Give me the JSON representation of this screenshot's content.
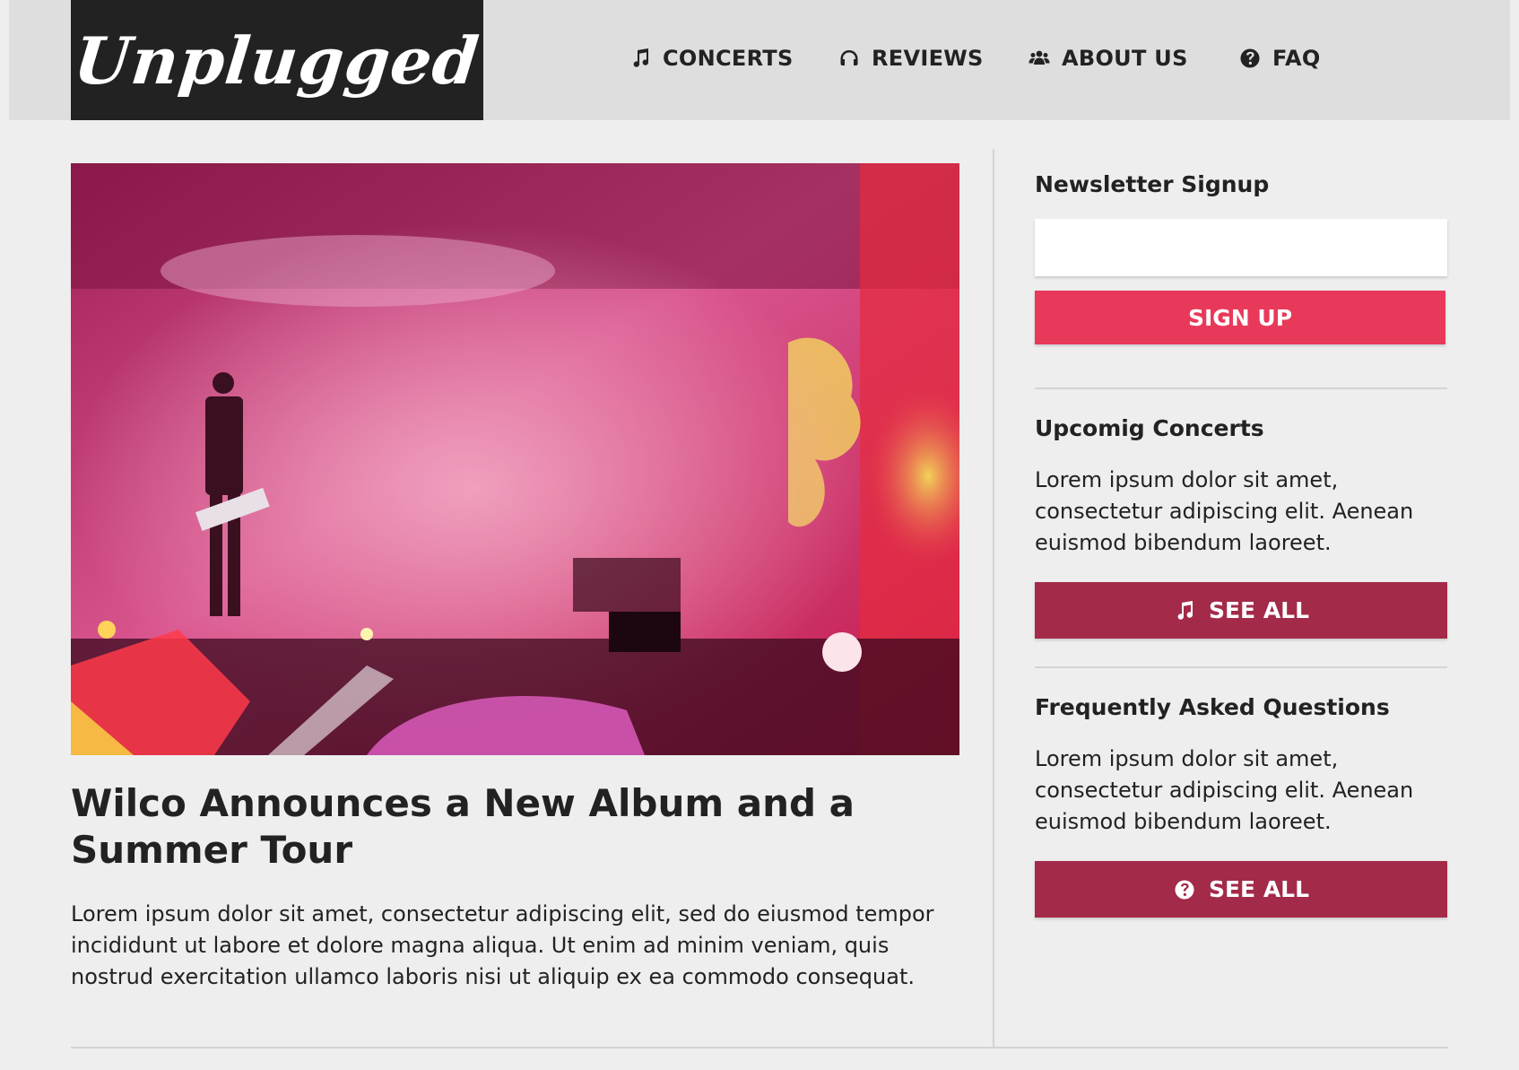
{
  "brand": {
    "logo_text": "Unplugged"
  },
  "nav": {
    "items": [
      {
        "label": "CONCERTS",
        "icon": "music-note-icon"
      },
      {
        "label": "REVIEWS",
        "icon": "headphones-icon"
      },
      {
        "label": "ABOUT US",
        "icon": "users-icon"
      },
      {
        "label": "FAQ",
        "icon": "question-circle-icon"
      }
    ]
  },
  "article": {
    "title": "Wilco Announces a New Album and a Summer Tour",
    "body": "Lorem ipsum dolor sit amet, consectetur adipiscing elit, sed do eiusmod tempor incididunt ut labore et dolore magna aliqua. Ut enim ad minim veniam, quis nostrud exercitation ullamco laboris nisi ut aliquip ex ea commodo consequat."
  },
  "sidebar": {
    "newsletter": {
      "heading": "Newsletter Signup",
      "input_value": "",
      "button_label": "SIGN UP"
    },
    "concerts": {
      "heading": "Upcomig Concerts",
      "text": "Lorem ipsum dolor sit amet, consectetur adipiscing elit. Aenean euismod bibendum laoreet.",
      "button_label": "SEE ALL",
      "button_icon": "music-note-icon"
    },
    "faq": {
      "heading": "Frequently Asked Questions",
      "text": "Lorem ipsum dolor sit amet, consectetur adipiscing elit. Aenean euismod bibendum laoreet.",
      "button_label": "SEE ALL",
      "button_icon": "question-circle-icon"
    }
  },
  "colors": {
    "header_bg": "#dedede",
    "logo_bg": "#222222",
    "page_bg": "#eeeeee",
    "signup_button": "#e9395a",
    "see_all_button": "#a32a48",
    "text": "#222222"
  }
}
